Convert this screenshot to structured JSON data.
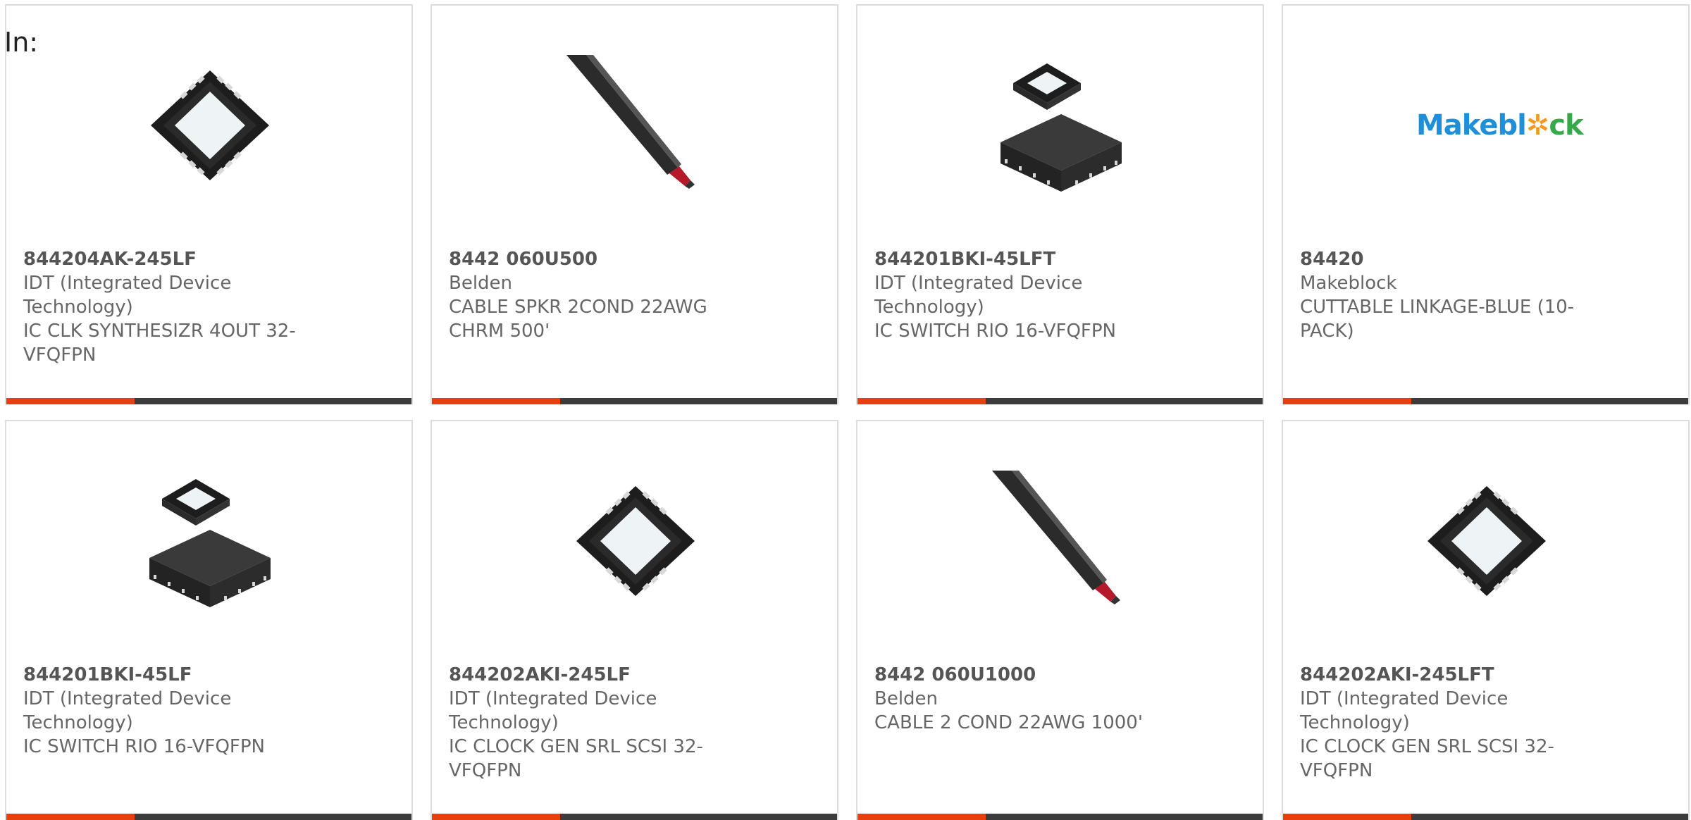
{
  "header": {
    "label": "In:"
  },
  "colors": {
    "accent": "#e8400c",
    "bar": "#3c3c3c",
    "border": "#dcdcdc"
  },
  "cards": [
    {
      "part_number": "844204AK-245LF",
      "manufacturer": "IDT (Integrated Device Technology)",
      "description": "IC CLK SYNTHESIZR 4OUT 32-VFQFPN",
      "image": "qfn-chip"
    },
    {
      "part_number": "8442 060U500",
      "manufacturer": "Belden",
      "description": "CABLE SPKR 2COND 22AWG CHRM 500'",
      "image": "cable"
    },
    {
      "part_number": "844201BKI-45LFT",
      "manufacturer": "IDT (Integrated Device Technology)",
      "description": "IC SWITCH RIO 16-VFQFPN",
      "image": "qfn-chip-stack"
    },
    {
      "part_number": "84420",
      "manufacturer": "Makeblock",
      "description": "CUTTABLE LINKAGE-BLUE (10-PACK)",
      "image": "makeblock-logo",
      "logo_text": "Makebl✲ck"
    },
    {
      "part_number": "844201BKI-45LF",
      "manufacturer": "IDT (Integrated Device Technology)",
      "description": "IC SWITCH RIO 16-VFQFPN",
      "image": "qfn-chip-stack"
    },
    {
      "part_number": "844202AKI-245LF",
      "manufacturer": "IDT (Integrated Device Technology)",
      "description": "IC CLOCK GEN SRL SCSI 32-VFQFPN",
      "image": "qfn-chip"
    },
    {
      "part_number": "8442 060U1000",
      "manufacturer": "Belden",
      "description": "CABLE 2 COND 22AWG 1000'",
      "image": "cable"
    },
    {
      "part_number": "844202AKI-245LFT",
      "manufacturer": "IDT (Integrated Device Technology)",
      "description": "IC CLOCK GEN SRL SCSI 32-VFQFPN",
      "image": "qfn-chip"
    }
  ]
}
